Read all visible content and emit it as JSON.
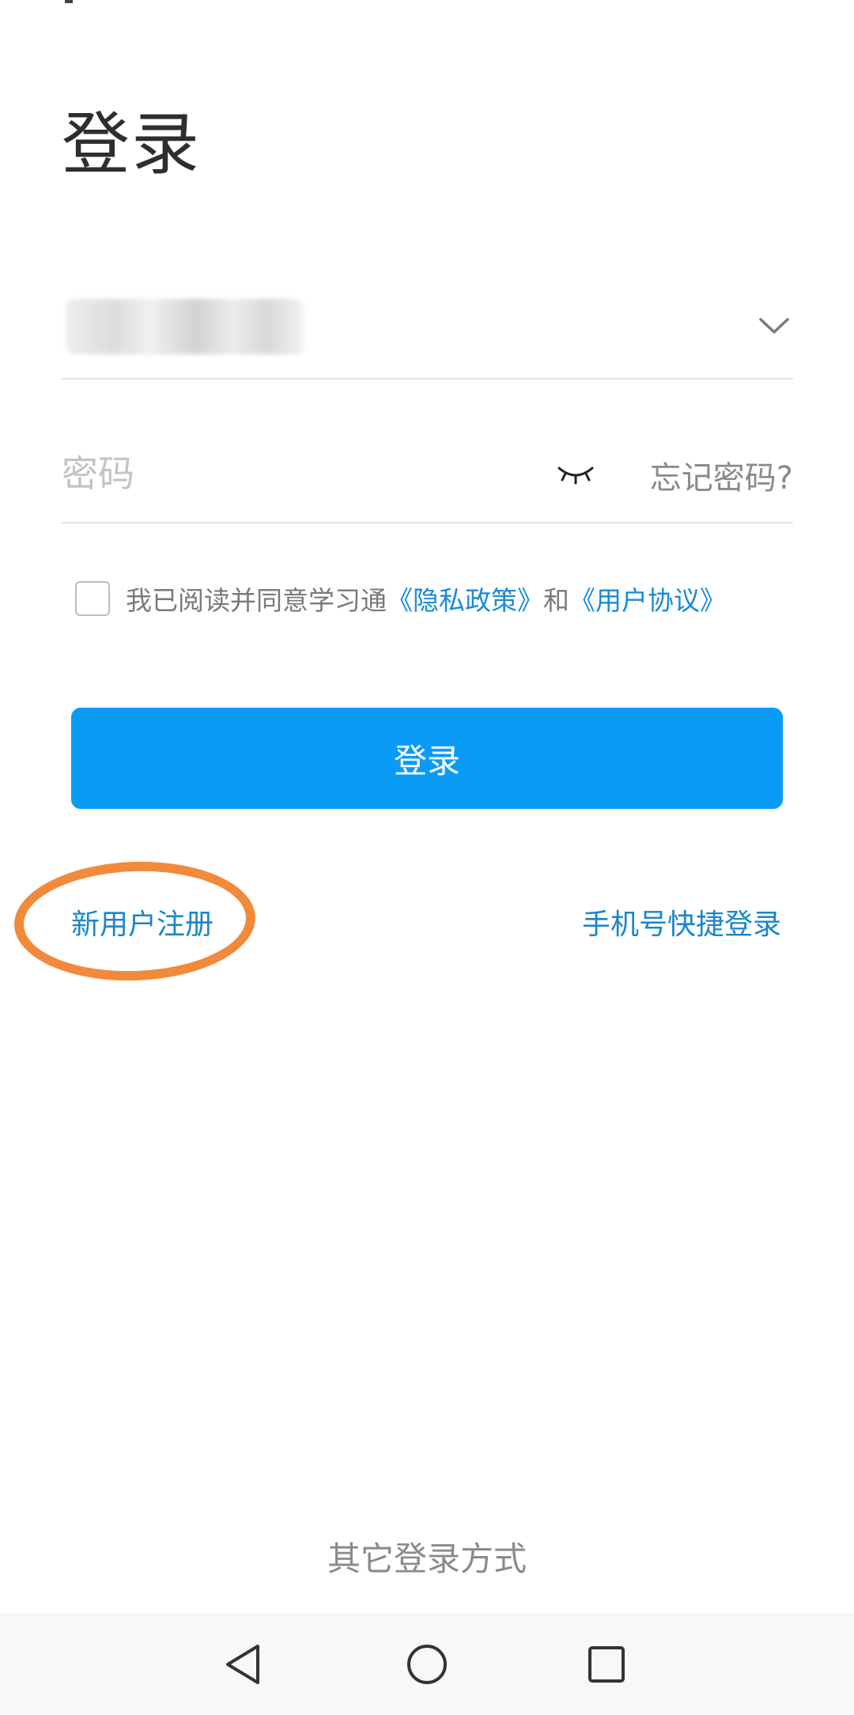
{
  "header": {
    "title": "登录"
  },
  "account": {
    "value": ""
  },
  "password": {
    "placeholder": "密码",
    "forgot_label": "忘记密码?"
  },
  "agreement": {
    "prefix": "我已阅读并同意学习通",
    "privacy_link": "《隐私政策》",
    "conjunction": "和",
    "terms_link": "《用户协议》"
  },
  "login_button": {
    "label": "登录"
  },
  "links": {
    "register": "新用户注册",
    "quick_login": "手机号快捷登录"
  },
  "other_login": {
    "label": "其它登录方式"
  },
  "colors": {
    "primary": "#0a9bf7",
    "link": "#1a86c8",
    "annotation": "#f28a3c"
  }
}
